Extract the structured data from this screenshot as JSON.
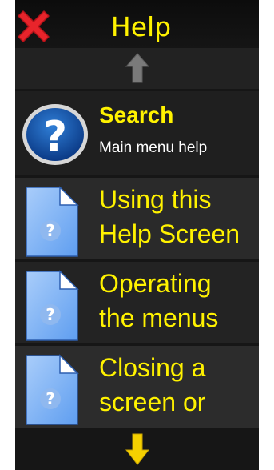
{
  "header": {
    "title": "Help",
    "close_icon": "close-icon"
  },
  "nav": {
    "scroll_up_icon": "arrow-up-icon",
    "scroll_down_icon": "arrow-down-icon",
    "up_color": "#7a7a7a",
    "down_color": "#f5d000"
  },
  "search": {
    "title": "Search",
    "subtitle": "Main menu help",
    "icon": "help-circle-icon"
  },
  "items": [
    {
      "label_line1": "Using this",
      "label_line2": "Help Screen",
      "icon": "help-document-icon"
    },
    {
      "label_line1": "Operating",
      "label_line2": "the menus",
      "icon": "help-document-icon"
    },
    {
      "label_line1": "Closing a",
      "label_line2": "screen or",
      "icon": "help-document-icon"
    }
  ],
  "colors": {
    "accent": "#fff200",
    "background": "#1b1b1b",
    "close": "#e8242b"
  }
}
